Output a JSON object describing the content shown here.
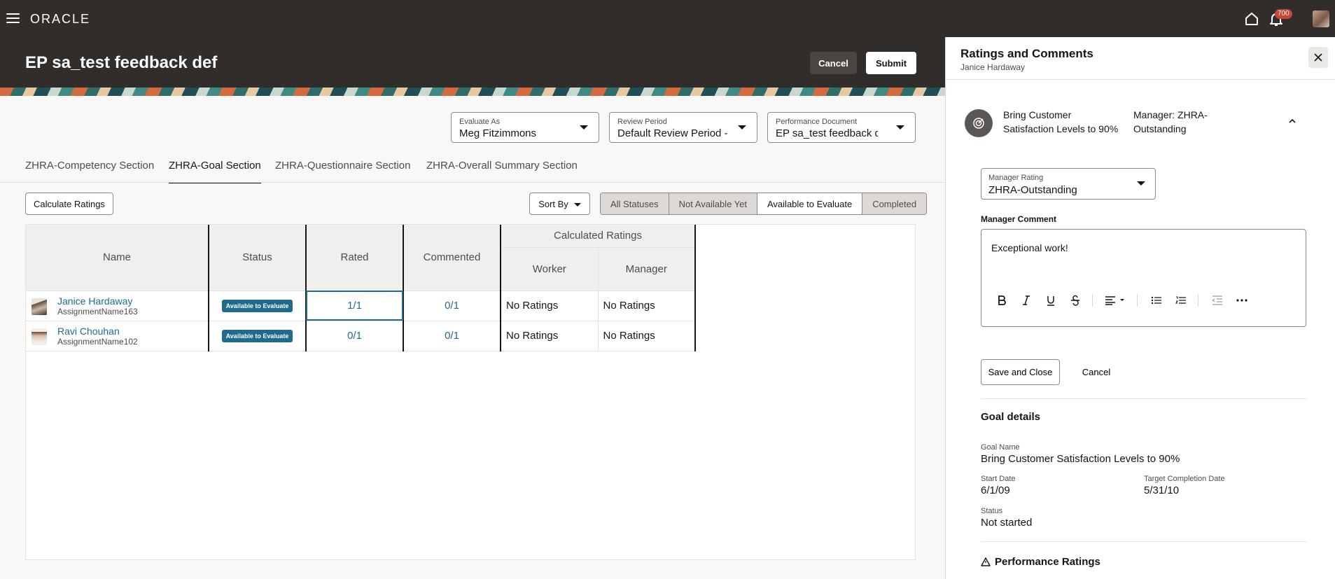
{
  "topbar": {
    "brand": "ORACLE",
    "notifications_count": "700",
    "icons": [
      "menu-icon",
      "home-icon",
      "bell-icon",
      "avatar"
    ]
  },
  "header": {
    "title": "EP sa_test feedback def",
    "cancel_label": "Cancel",
    "submit_label": "Submit"
  },
  "filters": {
    "evaluate_as": {
      "label": "Evaluate As",
      "value": "Meg Fitzimmons"
    },
    "review_period": {
      "label": "Review Period",
      "value": "Default Review Period -"
    },
    "performance_document": {
      "label": "Performance Document",
      "value": "EP sa_test feedback def"
    }
  },
  "tabs": [
    {
      "label": "ZHRA-Competency Section",
      "active": false
    },
    {
      "label": "ZHRA-Goal Section",
      "active": true
    },
    {
      "label": "ZHRA-Questionnaire Section",
      "active": false
    },
    {
      "label": "ZHRA-Overall Summary Section",
      "active": false
    }
  ],
  "toolbar": {
    "calculate_label": "Calculate Ratings",
    "sort_label": "Sort By",
    "status_filters": [
      {
        "label": "All Statuses",
        "selected": false
      },
      {
        "label": "Not Available Yet",
        "selected": false
      },
      {
        "label": "Available to Evaluate",
        "selected": true
      },
      {
        "label": "Completed",
        "selected": false
      }
    ]
  },
  "table": {
    "headers": {
      "name": "Name",
      "status": "Status",
      "rated": "Rated",
      "commented": "Commented",
      "calculated": "Calculated Ratings",
      "worker": "Worker",
      "manager": "Manager"
    },
    "rows": [
      {
        "name": "Janice Hardaway",
        "assignment": "AssignmentName163",
        "status": "Available to Evaluate",
        "rated": "1/1",
        "commented": "0/1",
        "worker": "No Ratings",
        "manager": "No Ratings"
      },
      {
        "name": "Ravi Chouhan",
        "assignment": "AssignmentName102",
        "status": "Available to Evaluate",
        "rated": "0/1",
        "commented": "0/1",
        "worker": "No Ratings",
        "manager": "No Ratings"
      }
    ]
  },
  "drawer": {
    "title": "Ratings and Comments",
    "subtitle": "Janice Hardaway",
    "goal_title": "Bring Customer Satisfaction Levels to 90%",
    "goal_manager": "Manager: ZHRA-Outstanding",
    "manager_rating": {
      "label": "Manager Rating",
      "value": "ZHRA-Outstanding"
    },
    "comment_label": "Manager Comment",
    "comment_text": "Exceptional work!",
    "save_label": "Save and Close",
    "cancel_label": "Cancel",
    "goal_details": {
      "heading": "Goal details",
      "goal_name_label": "Goal Name",
      "goal_name": "Bring Customer Satisfaction Levels to 90%",
      "start_date_label": "Start Date",
      "start_date": "6/1/09",
      "target_label": "Target Completion Date",
      "target_date": "5/31/10",
      "status_label": "Status",
      "status": "Not started"
    },
    "performance_heading": "Performance Ratings"
  },
  "colors": {
    "header_bg": "#312d2a",
    "link": "#1f6b8d",
    "status_pill": "#1f6b8d",
    "badge": "#c74634"
  }
}
